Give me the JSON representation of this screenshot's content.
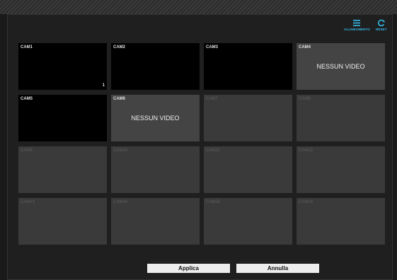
{
  "toolbar": {
    "align_label": "ALLINEAMENTO",
    "align_icon": "list-icon",
    "reset_label": "RESET",
    "reset_icon": "refresh-icon",
    "accent_color": "#35b9e9"
  },
  "cameras": [
    {
      "label": "CAM1",
      "state": "live",
      "number": "1"
    },
    {
      "label": "CAM2",
      "state": "live"
    },
    {
      "label": "CAM3",
      "state": "live"
    },
    {
      "label": "CAM4",
      "state": "no-video",
      "message": "NESSUN VIDEO"
    },
    {
      "label": "CAM5",
      "state": "live"
    },
    {
      "label": "CAM6",
      "state": "no-video",
      "message": "NESSUN VIDEO"
    },
    {
      "label": "CAM7",
      "state": "disabled"
    },
    {
      "label": "CAM8",
      "state": "disabled"
    },
    {
      "label": "CAM9",
      "state": "disabled"
    },
    {
      "label": "CAM10",
      "state": "disabled"
    },
    {
      "label": "CAM11",
      "state": "disabled"
    },
    {
      "label": "CAM12",
      "state": "disabled"
    },
    {
      "label": "CAM13",
      "state": "disabled"
    },
    {
      "label": "CAM14",
      "state": "disabled"
    },
    {
      "label": "CAM15",
      "state": "disabled"
    },
    {
      "label": "CAM16",
      "state": "disabled"
    }
  ],
  "buttons": {
    "apply": "Applica",
    "cancel": "Annulla"
  }
}
